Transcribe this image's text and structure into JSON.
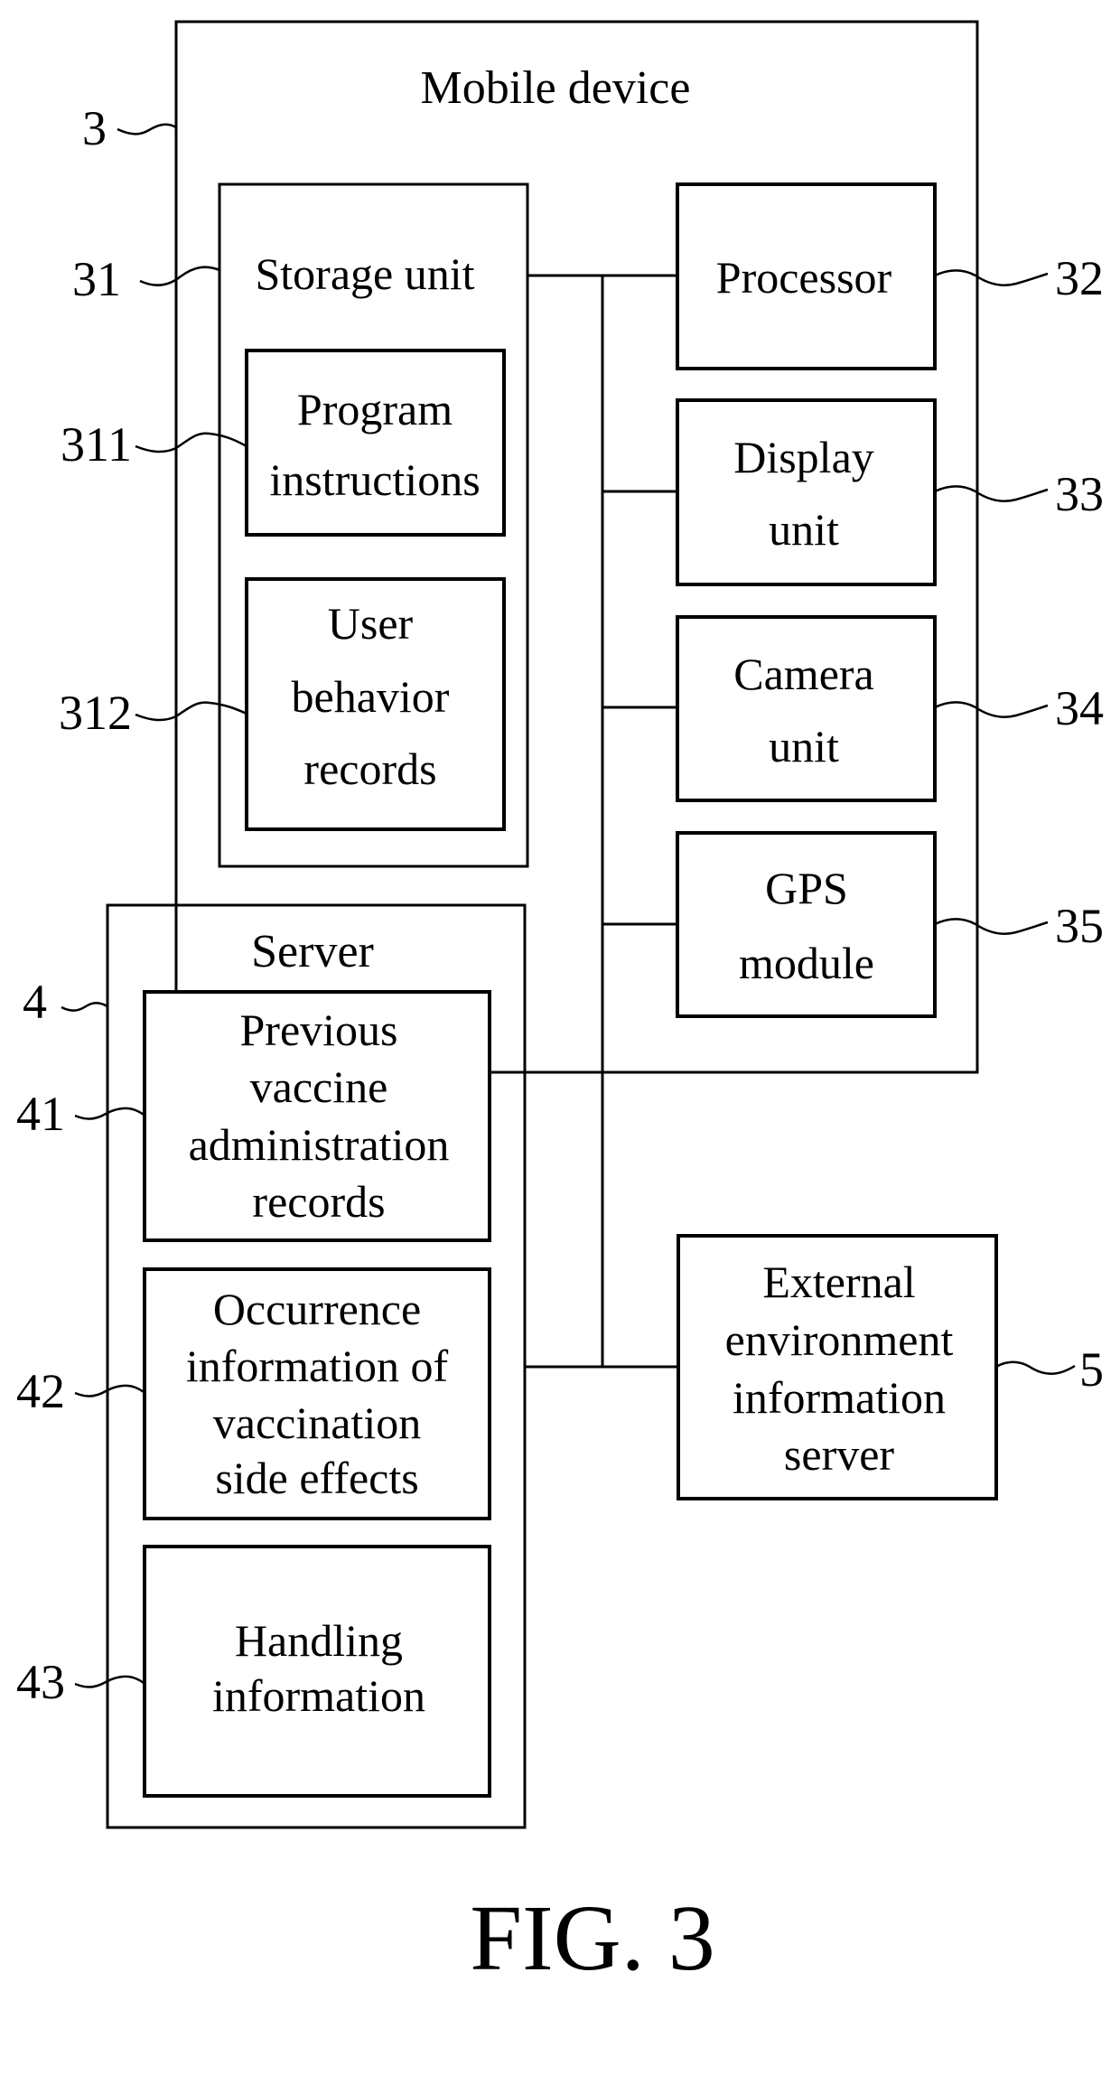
{
  "figure_label": "FIG. 3",
  "mobile_device": {
    "ref": "3",
    "title": "Mobile device",
    "storage_unit": {
      "ref": "31",
      "title": "Storage unit",
      "program_instructions": {
        "ref": "311",
        "lines": [
          "Program",
          "instructions"
        ]
      },
      "user_behavior_records": {
        "ref": "312",
        "lines": [
          "User",
          "behavior",
          "records"
        ]
      }
    },
    "processor": {
      "ref": "32",
      "lines": [
        "Processor"
      ]
    },
    "display_unit": {
      "ref": "33",
      "lines": [
        "Display",
        "unit"
      ]
    },
    "camera_unit": {
      "ref": "34",
      "lines": [
        "Camera",
        "unit"
      ]
    },
    "gps_module": {
      "ref": "35",
      "lines": [
        "GPS",
        "module"
      ]
    }
  },
  "server": {
    "ref": "4",
    "title": "Server",
    "previous_vaccine_records": {
      "ref": "41",
      "lines": [
        "Previous",
        "vaccine",
        "administration",
        "records"
      ]
    },
    "side_effects_info": {
      "ref": "42",
      "lines": [
        "Occurrence",
        "information of",
        "vaccination",
        "side effects"
      ]
    },
    "handling_info": {
      "ref": "43",
      "lines": [
        "Handling",
        "information"
      ]
    }
  },
  "external_server": {
    "ref": "5",
    "lines": [
      "External",
      "environment",
      "information",
      "server"
    ]
  }
}
